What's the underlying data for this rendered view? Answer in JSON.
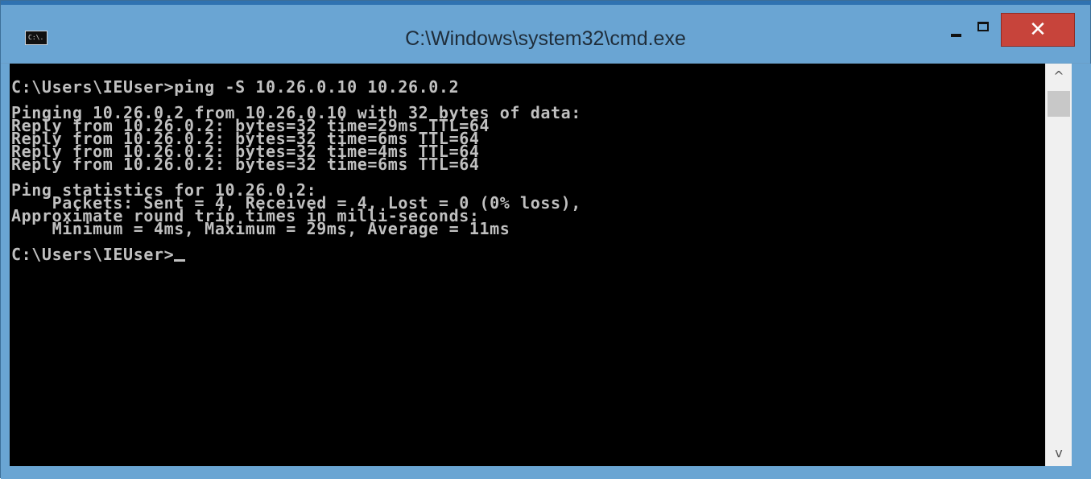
{
  "window": {
    "title": "C:\\Windows\\system32\\cmd.exe",
    "icon_label": "C:\\.",
    "buttons": {
      "minimize_icon": "minimize-icon",
      "maximize_icon": "maximize-icon",
      "close_glyph": "✕"
    },
    "colors": {
      "titlebar": "#6aa5d3",
      "close_button": "#c7443b",
      "console_background": "#000000",
      "console_text": "#c0c0c0"
    }
  },
  "console": {
    "lines": [
      "C:\\Users\\IEUser>ping -S 10.26.0.10 10.26.0.2",
      "",
      "Pinging 10.26.0.2 from 10.26.0.10 with 32 bytes of data:",
      "Reply from 10.26.0.2: bytes=32 time=29ms TTL=64",
      "Reply from 10.26.0.2: bytes=32 time=6ms TTL=64",
      "Reply from 10.26.0.2: bytes=32 time=4ms TTL=64",
      "Reply from 10.26.0.2: bytes=32 time=6ms TTL=64",
      "",
      "Ping statistics for 10.26.0.2:",
      "    Packets: Sent = 4, Received = 4, Lost = 0 (0% loss),",
      "Approximate round trip times in milli-seconds:",
      "    Minimum = 4ms, Maximum = 29ms, Average = 11ms",
      "",
      "C:\\Users\\IEUser>"
    ]
  },
  "scrollbar": {
    "up_arrow": "^",
    "down_arrow": "v"
  }
}
